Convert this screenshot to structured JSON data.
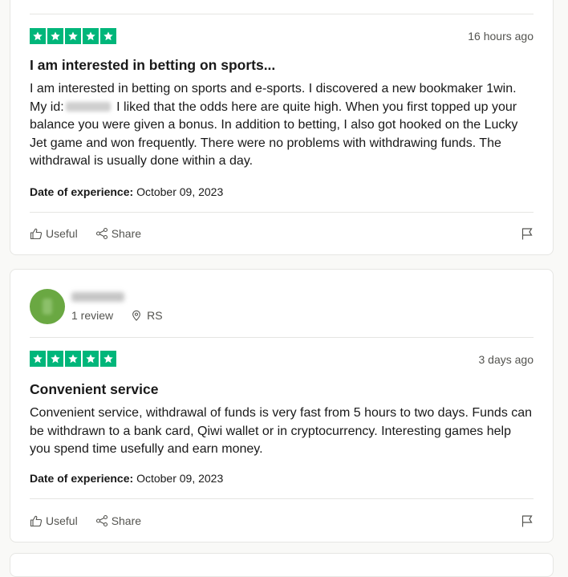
{
  "colors": {
    "star_green": "#00b67a",
    "accent_text": "#191919",
    "muted_text": "#545450"
  },
  "reviews": [
    {
      "rating": 5,
      "date": "16 hours ago",
      "title": "I am interested in betting on sports...",
      "body_before_id": "I am interested in betting on sports and e-sports. I discovered a new bookmaker 1win. My id:",
      "body_after_id": " I liked that the odds here are quite high. When you first topped up your balance you were given a bonus. In addition to betting, I also got hooked on the Lucky Jet game and won frequently. There were no problems with withdrawing funds. The withdrawal is usually done within a day.",
      "experience_label": "Date of experience:",
      "experience_date": "October 09, 2023",
      "useful_label": "Useful",
      "share_label": "Share"
    },
    {
      "rating": 5,
      "review_count": "1 review",
      "country": "RS",
      "date": "3 days ago",
      "title": "Convenient service",
      "body": "Convenient service, withdrawal of funds is very fast from 5 hours to two days. Funds can be withdrawn to a bank card, Qiwi wallet or in cryptocurrency. Interesting games help you spend time usefully and earn money.",
      "experience_label": "Date of experience:",
      "experience_date": "October 09, 2023",
      "useful_label": "Useful",
      "share_label": "Share"
    }
  ]
}
